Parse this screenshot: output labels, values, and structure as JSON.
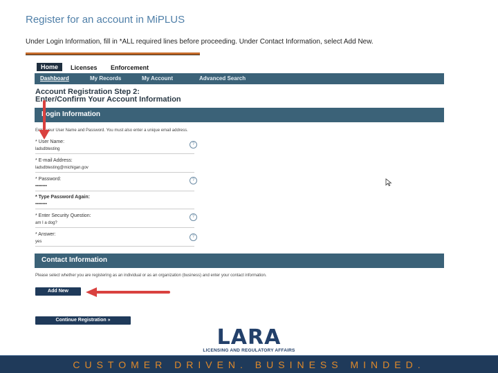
{
  "slide": {
    "title": "Register for an account in MiPLUS",
    "instruction": "Under Login Information, fill in *ALL required lines before proceeding. Under Contact Information, select Add New."
  },
  "topnav": {
    "tabs": [
      "Home",
      "Licenses",
      "Enforcement"
    ]
  },
  "subnav": {
    "items": [
      "Dashboard",
      "My Records",
      "My Account",
      "Advanced Search"
    ]
  },
  "step": {
    "line1": "Account Registration Step 2:",
    "line2": "Enter/Confirm Your Account Information"
  },
  "login": {
    "header": "Login Information",
    "help": "Enter your User Name and Password. You must also enter a unique email address.",
    "fields": [
      {
        "label": "* User Name:",
        "value": "ladsdbtesting"
      },
      {
        "label": "* E-mail Address:",
        "value": "ladsdbtesting@michigan.gov"
      },
      {
        "label": "* Password:",
        "value": "••••••••"
      },
      {
        "label": "* Type Password Again:",
        "value": "••••••••"
      },
      {
        "label": "* Enter Security Question:",
        "value": "am I a dog?"
      },
      {
        "label": "* Answer:",
        "value": "yes"
      }
    ]
  },
  "contact": {
    "header": "Contact Information",
    "help": "Please select whether you are registering as an individual or as an organization (business) and enter your contact information.",
    "add_new": "Add New",
    "continue": "Continue Registration »"
  },
  "logo": {
    "word": "LARA",
    "sub": "LICENSING AND REGULATORY AFFAIRS"
  },
  "footer": {
    "tagline": "CUSTOMER DRIVEN. BUSINESS MINDED."
  },
  "colors": {
    "accent": "#3b6278",
    "brand": "#1f3a5a",
    "arrow": "#d9413f",
    "footer_text": "#e08a2a"
  }
}
